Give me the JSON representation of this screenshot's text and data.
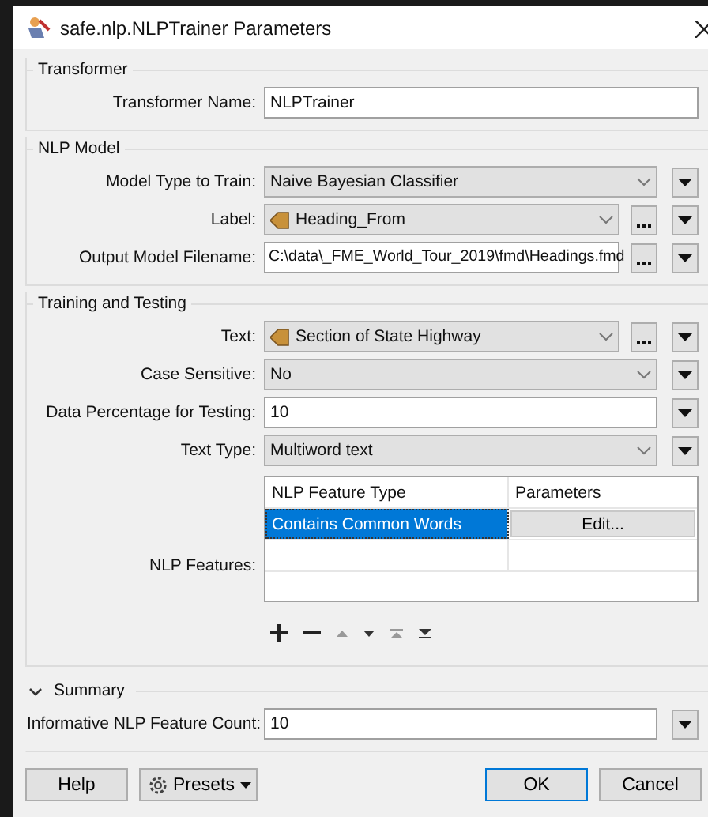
{
  "window": {
    "title": "safe.nlp.NLPTrainer Parameters"
  },
  "sections": [
    {
      "title": "Transformer",
      "rows": [
        {
          "kind": "text",
          "label": "Transformer Name:",
          "value": "NLPTrainer"
        }
      ]
    },
    {
      "title": "NLP Model",
      "rows": [
        {
          "kind": "choice",
          "label": "Model Type to Train:",
          "value": "Naive Bayesian Classifier"
        },
        {
          "kind": "attribute",
          "label": "Label:",
          "value": "Heading_From"
        },
        {
          "kind": "file",
          "label": "Output Model Filename:",
          "value": "C:\\data\\_FME_World_Tour_2019\\fmd\\Headings.fmd"
        }
      ]
    },
    {
      "title": "Training and Testing",
      "rows": [
        {
          "kind": "attribute",
          "label": "Text:",
          "value": "Section of State Highway"
        },
        {
          "kind": "choice",
          "label": "Case Sensitive:",
          "value": "No"
        },
        {
          "kind": "number",
          "label": "Data Percentage for Testing:",
          "value": "10"
        },
        {
          "kind": "choice",
          "label": "Text Type:",
          "value": "Multiword text"
        },
        {
          "kind": "table",
          "label": "NLP Features:",
          "columns": [
            "NLP Feature Type",
            "Parameters"
          ],
          "rows": [
            {
              "feature": "Contains Common Words",
              "parameters": "Edit...",
              "selected": true
            }
          ]
        }
      ]
    },
    {
      "title": "Summary",
      "expanded": true,
      "rows": [
        {
          "kind": "number",
          "label": "Informative NLP Feature Count:",
          "value": "10"
        }
      ]
    }
  ],
  "buttons": [
    {
      "label": "Help",
      "kind": "plain"
    },
    {
      "label": "Presets",
      "kind": "menu"
    },
    {
      "label": "OK",
      "kind": "default"
    },
    {
      "label": "Cancel",
      "kind": "plain"
    }
  ]
}
